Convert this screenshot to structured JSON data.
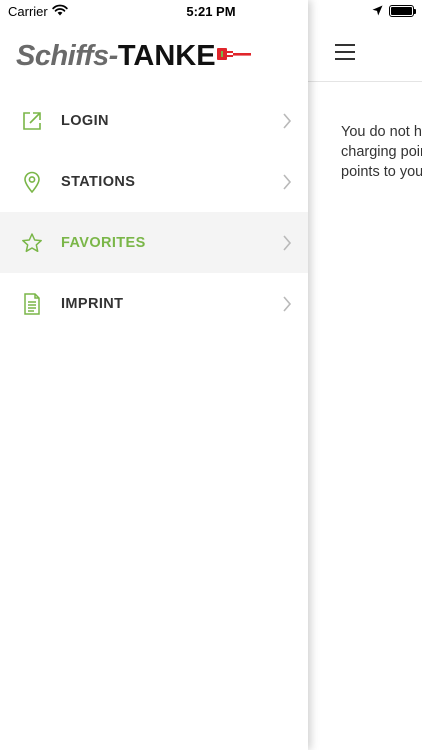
{
  "status_bar": {
    "carrier": "Carrier",
    "time": "5:21 PM",
    "icons": [
      "wifi-icon",
      "location-arrow-icon",
      "battery-icon"
    ]
  },
  "brand": {
    "logo_part1": "Schiffs-",
    "logo_part2": "TANKE",
    "accent_color": "#7ab648",
    "plug_color": "#e0262b"
  },
  "menu": {
    "items": [
      {
        "label": "LOGIN",
        "icon": "external-link-icon",
        "active": false
      },
      {
        "label": "STATIONS",
        "icon": "map-pin-icon",
        "active": false
      },
      {
        "label": "FAVORITES",
        "icon": "star-icon",
        "active": true
      },
      {
        "label": "IMPRINT",
        "icon": "document-icon",
        "active": false
      }
    ]
  },
  "main": {
    "empty_message": "You do not have any favorite charging points. Add charging points to your favorites."
  }
}
